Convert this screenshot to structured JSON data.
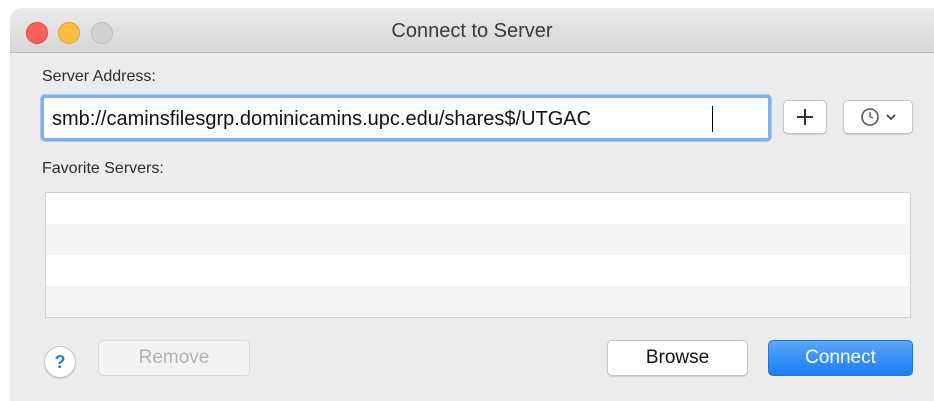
{
  "window": {
    "title": "Connect to Server"
  },
  "server_address": {
    "label": "Server Address:",
    "value": "smb://caminsfilesgrp.dominicamins.upc.edu/shares$/UTGAC",
    "add_icon": "plus-icon",
    "recent_icon": "clock-icon",
    "recent_chevron": "chevron-down-icon"
  },
  "favorites": {
    "label": "Favorite Servers:",
    "items": []
  },
  "footer": {
    "help_label": "?",
    "remove_label": "Remove",
    "browse_label": "Browse",
    "connect_label": "Connect"
  },
  "colors": {
    "close": "#fc605b",
    "minimize": "#fdbc40",
    "zoom": "#d1d1d1",
    "accent": "#1a7df7",
    "focus_ring": "#7fb0f0"
  }
}
